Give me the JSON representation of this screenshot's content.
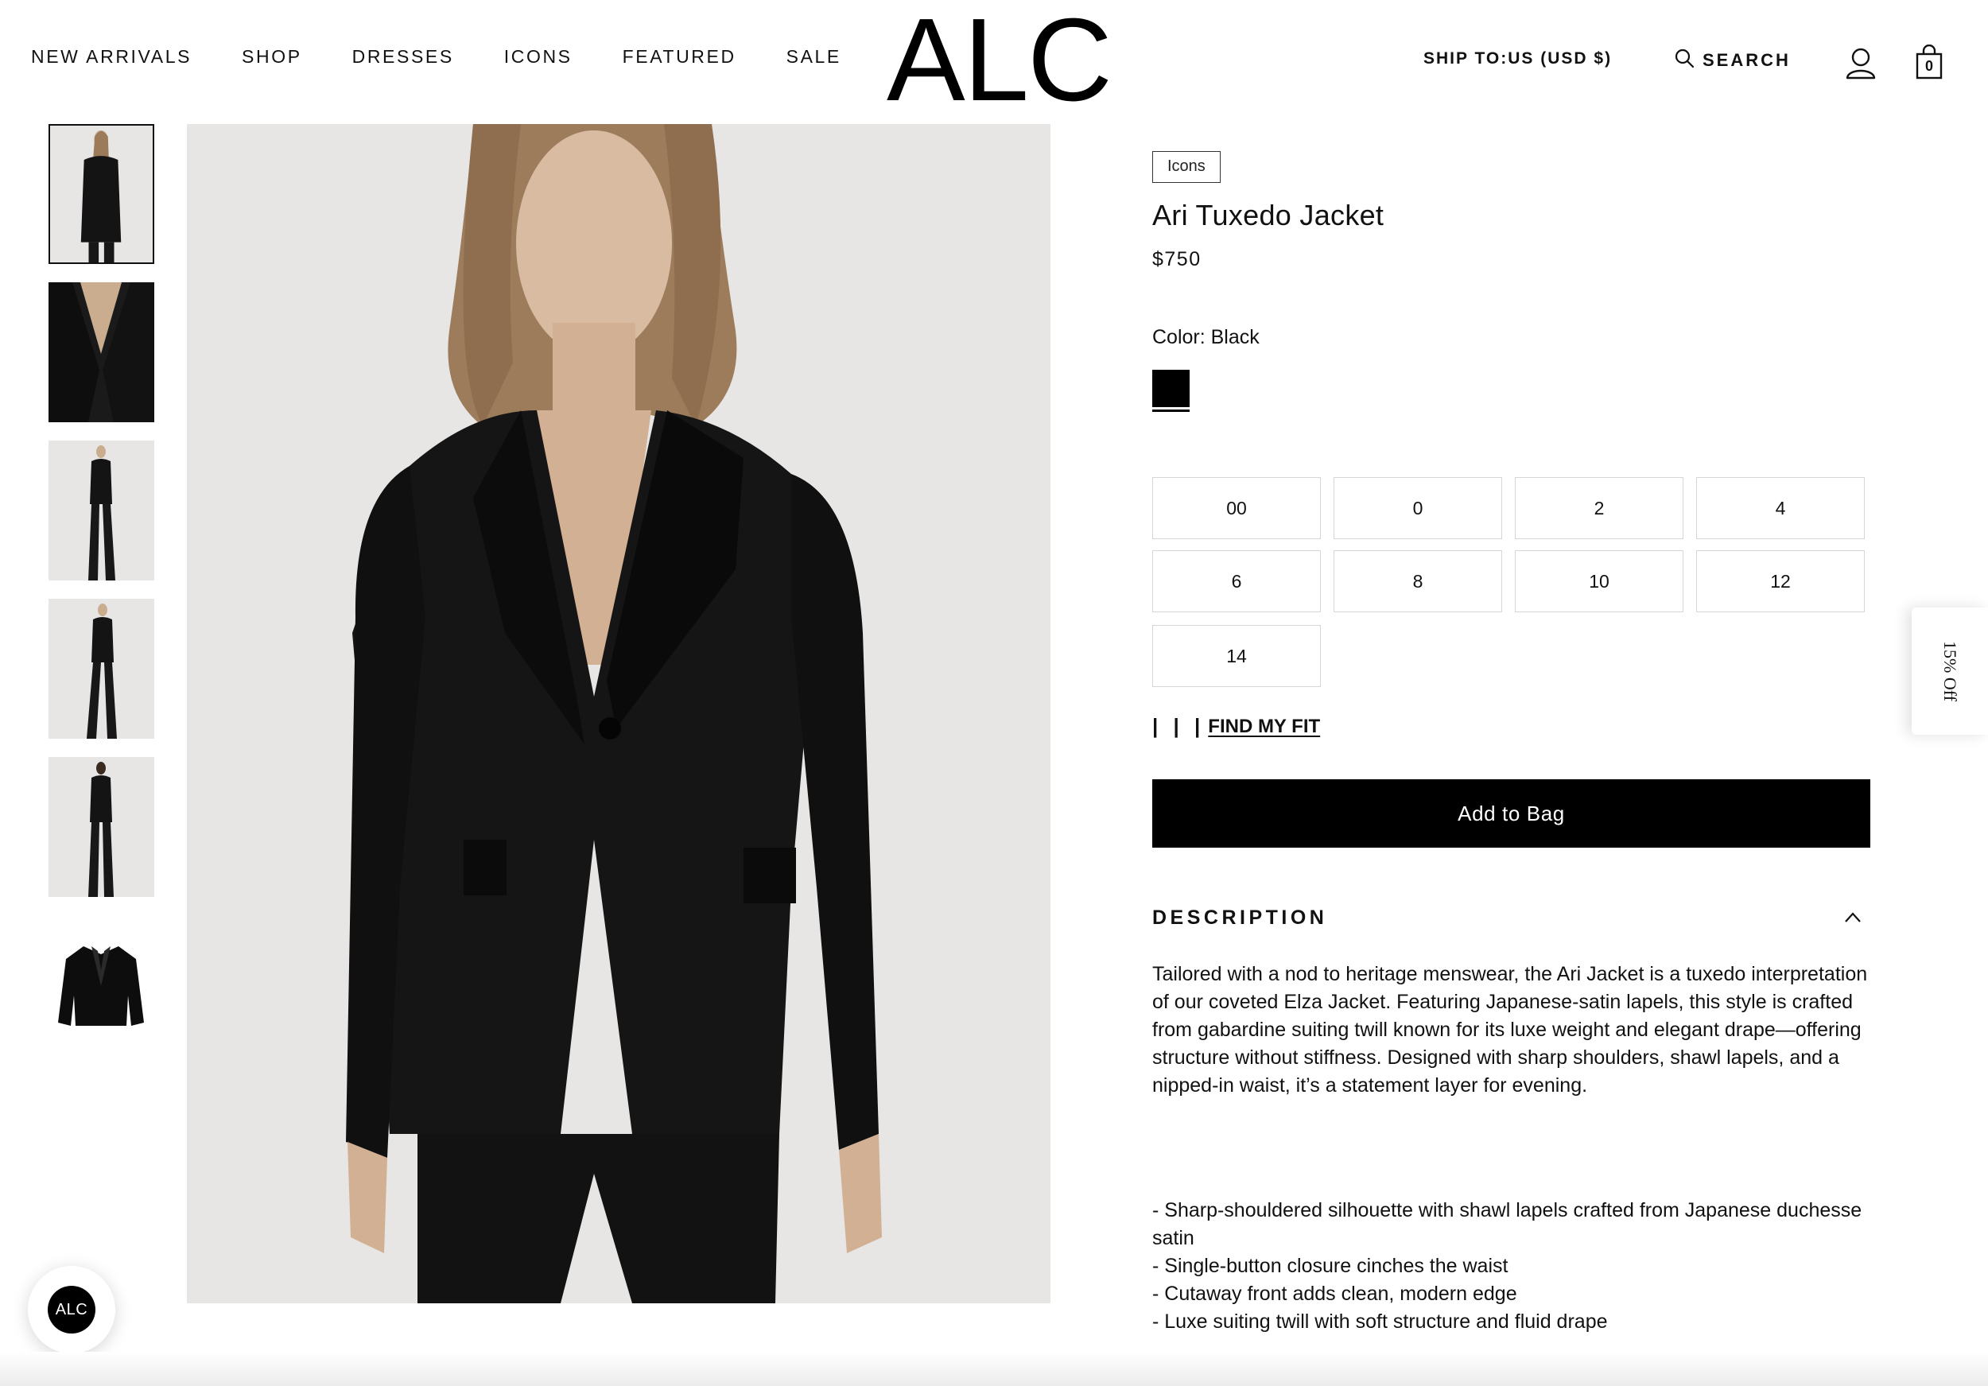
{
  "header": {
    "nav": [
      "NEW ARRIVALS",
      "SHOP",
      "DRESSES",
      "ICONS",
      "FEATURED",
      "SALE"
    ],
    "logo": "ALC",
    "ship_to": "SHIP TO:US (USD $)",
    "search_label": "SEARCH",
    "bag_count": "0"
  },
  "product": {
    "badge": "Icons",
    "title": "Ari Tuxedo Jacket",
    "price": "$750",
    "color_label": "Color: Black",
    "swatch_color": "#000000",
    "sizes": [
      "00",
      "0",
      "2",
      "4",
      "6",
      "8",
      "10",
      "12",
      "14"
    ],
    "find_fit_bars": "| | |",
    "find_fit_label": "FIND MY FIT",
    "add_to_bag": "Add to Bag"
  },
  "description": {
    "heading": "DESCRIPTION",
    "text": "Tailored with a nod to heritage menswear, the Ari Jacket is a tuxedo interpretation of our coveted Elza Jacket. Featuring Japanese-satin lapels, this style is crafted from gabardine suiting twill known for its luxe weight and elegant drape—offering structure without stiffness. Designed with sharp shoulders, shawl lapels, and a nipped-in waist, it’s a statement layer for evening.",
    "bullets": [
      "- Sharp-shouldered silhouette with shawl lapels crafted from Japanese duchesse satin",
      "- Single-button closure cinches the waist",
      "- Cutaway front adds clean, modern edge",
      "- Luxe suiting twill with soft structure and fluid drape"
    ]
  },
  "side_tab": {
    "label": "15% Off"
  },
  "chat": {
    "label": "ALC"
  },
  "colors": {
    "accent": "#000000",
    "image_bg": "#e7e6e4",
    "border": "#d6d6d6"
  }
}
